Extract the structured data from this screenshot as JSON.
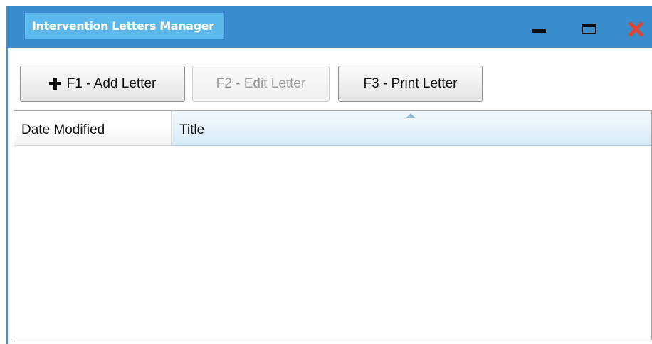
{
  "window": {
    "title": "Intervention Letters Manager",
    "controls": {
      "minimize_icon": "minimize-icon",
      "maximize_icon": "maximize-icon",
      "close_icon": "close-icon"
    },
    "colors": {
      "titlebar": "#3a8dcc",
      "title_tab": "#5cb7ec",
      "close": "#e0452f"
    }
  },
  "toolbar": {
    "add_label": "F1 - Add Letter",
    "add_icon": "plus-icon",
    "edit_label": "F2 - Edit Letter",
    "edit_enabled": false,
    "print_label": "F3 - Print Letter"
  },
  "grid": {
    "columns": [
      {
        "label": "Date Modified",
        "sorted": false
      },
      {
        "label": "Title",
        "sorted": true,
        "sort_direction": "ascending"
      }
    ],
    "rows": []
  }
}
